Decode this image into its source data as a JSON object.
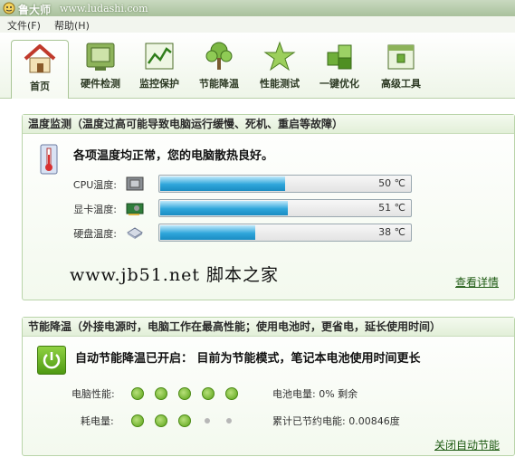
{
  "app": {
    "title": "鲁大师",
    "url": "www.ludashi.com"
  },
  "menu": [
    "文件(F)",
    "帮助(H)"
  ],
  "toolbar": [
    {
      "label": "首页",
      "icon": "home-icon"
    },
    {
      "label": "硬件检测",
      "icon": "hardware-icon"
    },
    {
      "label": "监控保护",
      "icon": "monitor-chart-icon"
    },
    {
      "label": "节能降温",
      "icon": "tree-icon"
    },
    {
      "label": "性能测试",
      "icon": "star-icon"
    },
    {
      "label": "一键优化",
      "icon": "cubes-icon"
    },
    {
      "label": "高级工具",
      "icon": "toolbox-icon"
    }
  ],
  "temp_panel": {
    "title": "温度监测（温度过高可能导致电脑运行缓慢、死机、重启等故障）",
    "status": "各项温度均正常，您的电脑散热良好。",
    "rows": [
      {
        "label": "CPU温度:",
        "value": "50 ℃",
        "level": 0.5,
        "device_icon": "cpu-icon"
      },
      {
        "label": "显卡温度:",
        "value": "51 ℃",
        "level": 0.51,
        "device_icon": "graphics-card-icon"
      },
      {
        "label": "硬盘温度:",
        "value": "38 ℃",
        "level": 0.38,
        "device_icon": "hard-disk-icon"
      }
    ],
    "watermark": "www.jb51.net  脚本之家",
    "details_link": "查看详情"
  },
  "energy_panel": {
    "title": "节能降温（外接电源时，电脑工作在最高性能；使用电池时，更省电，延长使用时间）",
    "status": "自动节能降温已开启： 目前为节能模式，笔记本电池使用时间更长",
    "perf_label": "电脑性能:",
    "perf_level": "5 of 5",
    "power_label": "耗电量:",
    "power_level": "3 of 5",
    "battery_text": "电池电量: 0% 剩余",
    "saved_text": "累计已节约电能: 0.00846度",
    "close_link": "关闭自动节能"
  },
  "colors": {
    "accent": "#5aa318",
    "bar_fill": "#2fa6db",
    "link": "#1d5a12"
  }
}
